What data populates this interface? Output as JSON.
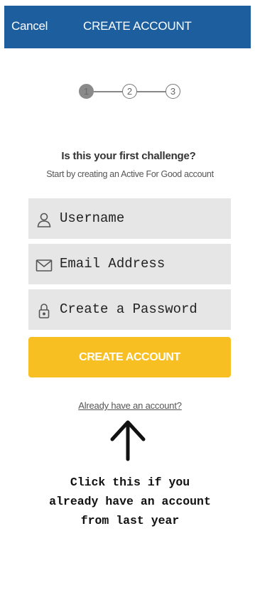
{
  "header": {
    "cancel_label": "Cancel",
    "title": "CREATE ACCOUNT",
    "background_color": "#1c5e9e"
  },
  "steps": [
    {
      "label": "1",
      "state": "active"
    },
    {
      "label": "2",
      "state": "inactive"
    },
    {
      "label": "3",
      "state": "inactive"
    }
  ],
  "intro": {
    "headline": "Is this your first challenge?",
    "subtext": "Start by creating an Active For Good account"
  },
  "form": {
    "username_placeholder": "Username",
    "username_icon": "user-icon",
    "email_placeholder": "Email Address",
    "email_icon": "envelope-icon",
    "password_placeholder": "Create a Password",
    "password_icon": "lock-icon",
    "submit_label": "CREATE ACCOUNT",
    "submit_color": "#f7bf22"
  },
  "login_link": "Already have an account?",
  "annotation": {
    "line1": "Click this if you",
    "line2": "already have an account",
    "line3": "from last year",
    "icon": "arrow-up-icon"
  }
}
